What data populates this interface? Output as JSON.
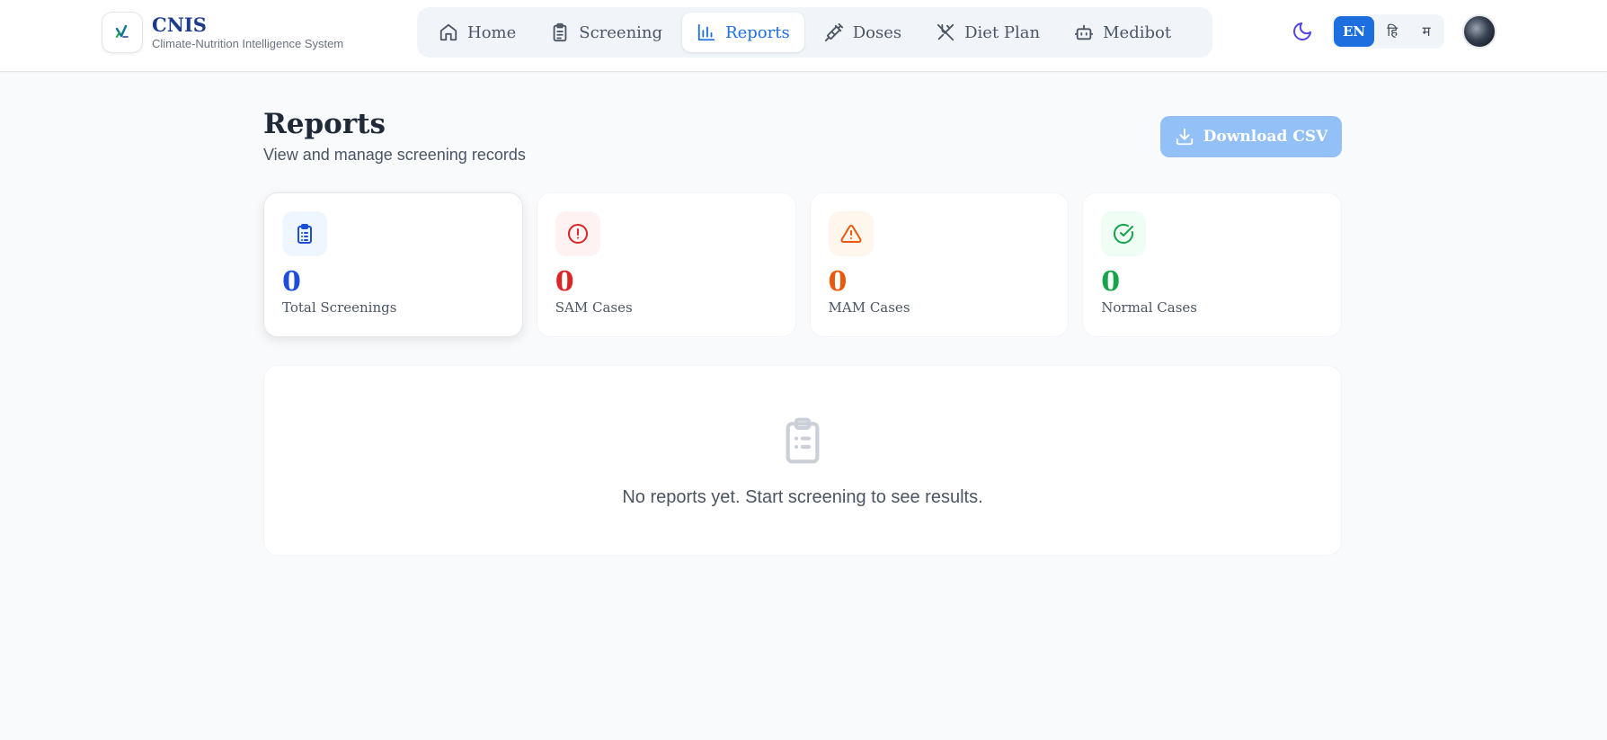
{
  "brand": {
    "title": "CNIS",
    "subtitle": "Climate-Nutrition Intelligence System"
  },
  "nav": {
    "items": [
      {
        "label": "Home",
        "icon": "home-icon"
      },
      {
        "label": "Screening",
        "icon": "clipboard-icon"
      },
      {
        "label": "Reports",
        "icon": "bar-chart-icon"
      },
      {
        "label": "Doses",
        "icon": "syringe-icon"
      },
      {
        "label": "Diet Plan",
        "icon": "utensils-icon"
      },
      {
        "label": "Medibot",
        "icon": "bot-icon"
      }
    ],
    "active": "Reports"
  },
  "language": {
    "options": [
      "EN",
      "हि",
      "म"
    ],
    "selected": "EN"
  },
  "page": {
    "title": "Reports",
    "subtitle": "View and manage screening records",
    "download_label": "Download CSV"
  },
  "stats": [
    {
      "value": "0",
      "label": "Total Screenings",
      "color": "#1d4ed8",
      "bg": "#eff6ff",
      "icon": "clipboard-list-icon"
    },
    {
      "value": "0",
      "label": "SAM Cases",
      "color": "#dc2626",
      "bg": "#fef2f2",
      "icon": "alert-circle-icon"
    },
    {
      "value": "0",
      "label": "MAM Cases",
      "color": "#ea580c",
      "bg": "#fff7ed",
      "icon": "alert-triangle-icon"
    },
    {
      "value": "0",
      "label": "Normal Cases",
      "color": "#16a34a",
      "bg": "#f0fdf4",
      "icon": "check-circle-icon"
    }
  ],
  "empty_state": {
    "message": "No reports yet. Start screening to see results.",
    "icon": "clipboard-list-icon"
  },
  "colors": {
    "accent": "#1d6fe0",
    "download_button": "#93c0f7",
    "brand_title": "#1e3a8a"
  }
}
